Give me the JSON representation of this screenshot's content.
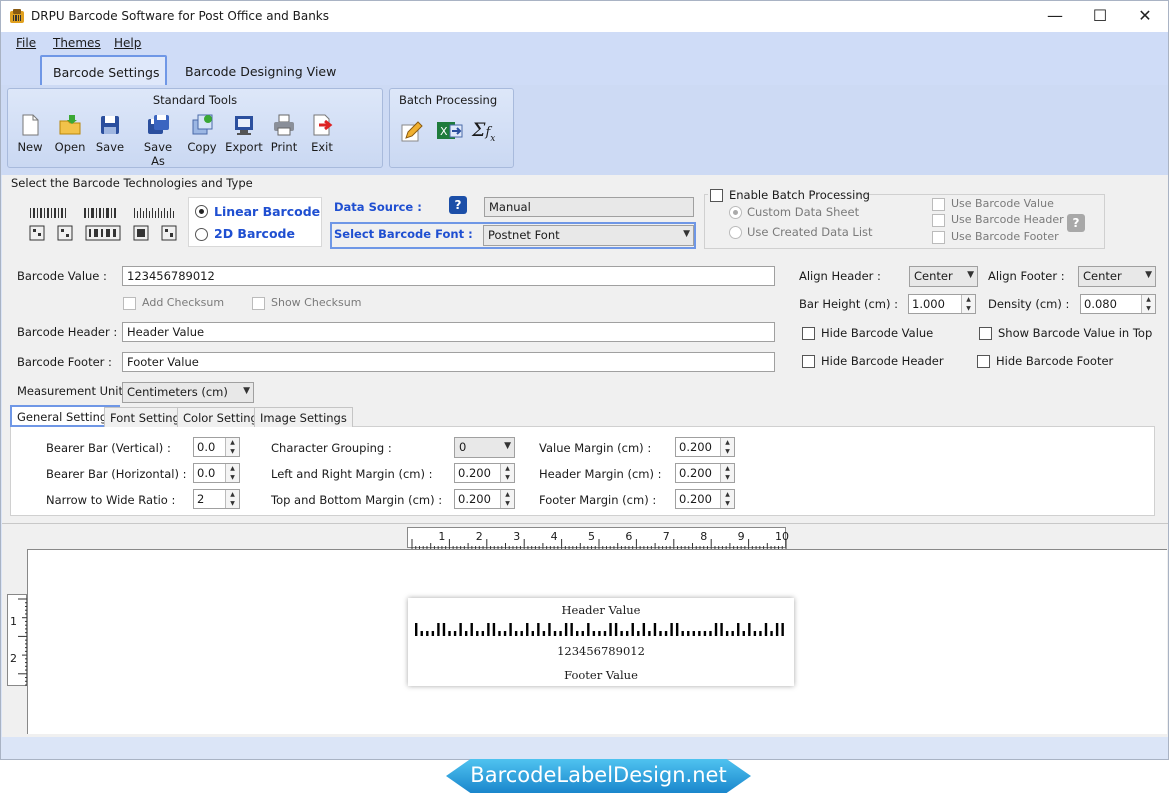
{
  "window": {
    "title": "DRPU Barcode Software for Post Office and Banks",
    "minimize": "—",
    "maximize": "☐",
    "close": "✕"
  },
  "menu": [
    "File",
    "Themes",
    "Help"
  ],
  "tabs": [
    "Barcode Settings",
    "Barcode Designing View"
  ],
  "ribbon": {
    "standard_title": "Standard Tools",
    "tools": [
      "New",
      "Open",
      "Save",
      "Save As",
      "Copy",
      "Export",
      "Print",
      "Exit"
    ],
    "batch_title": "Batch Processing"
  },
  "tech": {
    "title": "Select the Barcode Technologies and Type",
    "linear": "Linear Barcode",
    "twod": "2D Barcode",
    "data_source_label": "Data Source :",
    "data_source_value": "Manual",
    "font_label": "Select Barcode Font :",
    "font_value": "Postnet Font"
  },
  "batch": {
    "enable": "Enable Batch Processing",
    "custom": "Custom Data Sheet",
    "created": "Use Created Data List",
    "use_value": "Use Barcode Value",
    "use_header": "Use Barcode Header",
    "use_footer": "Use Barcode Footer",
    "help_icon": "?"
  },
  "form": {
    "value_label": "Barcode Value :",
    "value": "123456789012",
    "add_checksum": "Add Checksum",
    "show_checksum": "Show Checksum",
    "header_label": "Barcode Header :",
    "header": "Header Value",
    "footer_label": "Barcode Footer :",
    "footer": "Footer Value",
    "unit_label": "Measurement Unit :",
    "unit": "Centimeters (cm)"
  },
  "right": {
    "align_header_label": "Align Header :",
    "align_header": "Center",
    "align_footer_label": "Align Footer :",
    "align_footer": "Center",
    "bar_height_label": "Bar Height (cm) :",
    "bar_height": "1.000",
    "density_label": "Density (cm) :",
    "density": "0.080",
    "hide_value": "Hide Barcode Value",
    "show_value_top": "Show Barcode Value in Top",
    "hide_header": "Hide Barcode Header",
    "hide_footer": "Hide Barcode Footer"
  },
  "subtabs": [
    "General Settings",
    "Font Settings",
    "Color Settings",
    "Image Settings"
  ],
  "general": {
    "bearer_v_label": "Bearer Bar (Vertical) :",
    "bearer_v": "0.0",
    "bearer_h_label": "Bearer Bar (Horizontal) :",
    "bearer_h": "0.0",
    "ratio_label": "Narrow to Wide Ratio :",
    "ratio": "2",
    "grouping_label": "Character Grouping  :",
    "grouping": "0",
    "lr_margin_label": "Left and Right Margin (cm) :",
    "lr_margin": "0.200",
    "tb_margin_label": "Top and Bottom Margin (cm) :",
    "tb_margin": "0.200",
    "value_margin_label": "Value Margin (cm) :",
    "value_margin": "0.200",
    "header_margin_label": "Header Margin (cm) :",
    "header_margin": "0.200",
    "footer_margin_label": "Footer Margin (cm) :",
    "footer_margin": "0.200"
  },
  "ruler": {
    "h": [
      "1",
      "2",
      "3",
      "4",
      "5",
      "6",
      "7",
      "8",
      "9",
      "10"
    ],
    "v": [
      "1",
      "2"
    ]
  },
  "preview": {
    "header": "Header Value",
    "value": "123456789012",
    "footer": "Footer Value"
  },
  "watermark": "BarcodeLabelDesign.net"
}
